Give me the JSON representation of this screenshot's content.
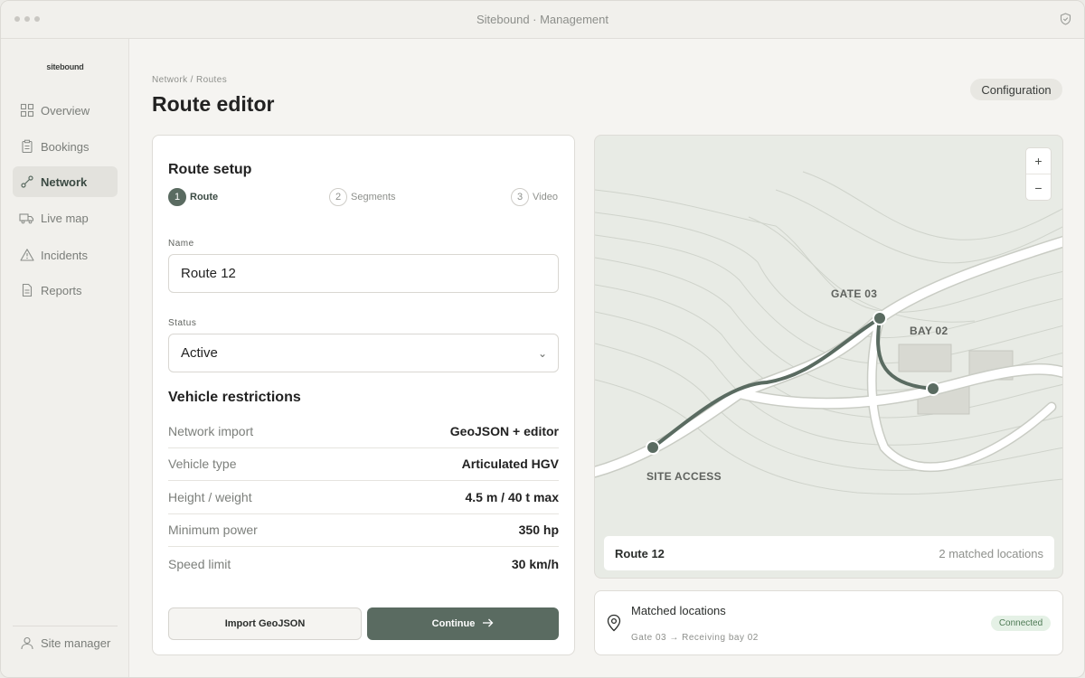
{
  "window": {
    "title": "Sitebound · Management"
  },
  "sidebar": {
    "logo": "sitebound",
    "items": [
      {
        "label": "Overview",
        "icon": "grid-icon",
        "active": false
      },
      {
        "label": "Bookings",
        "icon": "clipboard-icon",
        "active": false
      },
      {
        "label": "Network",
        "icon": "route-icon",
        "active": true
      },
      {
        "label": "Live map",
        "icon": "truck-icon",
        "active": false
      },
      {
        "label": "Incidents",
        "icon": "warning-icon",
        "active": false
      },
      {
        "label": "Reports",
        "icon": "document-icon",
        "active": false
      }
    ],
    "user": "Site manager"
  },
  "header": {
    "breadcrumb": "Network / Routes",
    "title": "Route editor",
    "config_button": "Configuration"
  },
  "form": {
    "title": "Route setup",
    "steps": [
      {
        "num": "1",
        "label": "Route",
        "active": true
      },
      {
        "num": "2",
        "label": "Segments",
        "active": false
      },
      {
        "num": "3",
        "label": "Video",
        "active": false
      }
    ],
    "name_label": "Name",
    "name_value": "Route 12",
    "status_label": "Status",
    "status_value": "Active",
    "restrictions_title": "Vehicle restrictions",
    "restrictions": [
      {
        "key": "Network import",
        "value": "GeoJSON + editor"
      },
      {
        "key": "Vehicle type",
        "value": "Articulated HGV"
      },
      {
        "key": "Height / weight",
        "value": "4.5 m / 40 t max"
      },
      {
        "key": "Minimum power",
        "value": "350 hp"
      },
      {
        "key": "Speed limit",
        "value": "30 km/h"
      }
    ],
    "import_button": "Import GeoJSON",
    "continue_button": "Continue"
  },
  "map": {
    "zoom_in": "+",
    "zoom_out": "−",
    "labels": {
      "gate": "GATE 03",
      "bay": "BAY 02",
      "access": "SITE ACCESS"
    },
    "footer_route": "Route 12",
    "footer_matches": "2 matched locations",
    "route_color": "#5a6b61"
  },
  "locations": {
    "title": "Matched locations",
    "subtitle": "Gate 03 → Receiving bay 02",
    "badge": "Connected"
  }
}
